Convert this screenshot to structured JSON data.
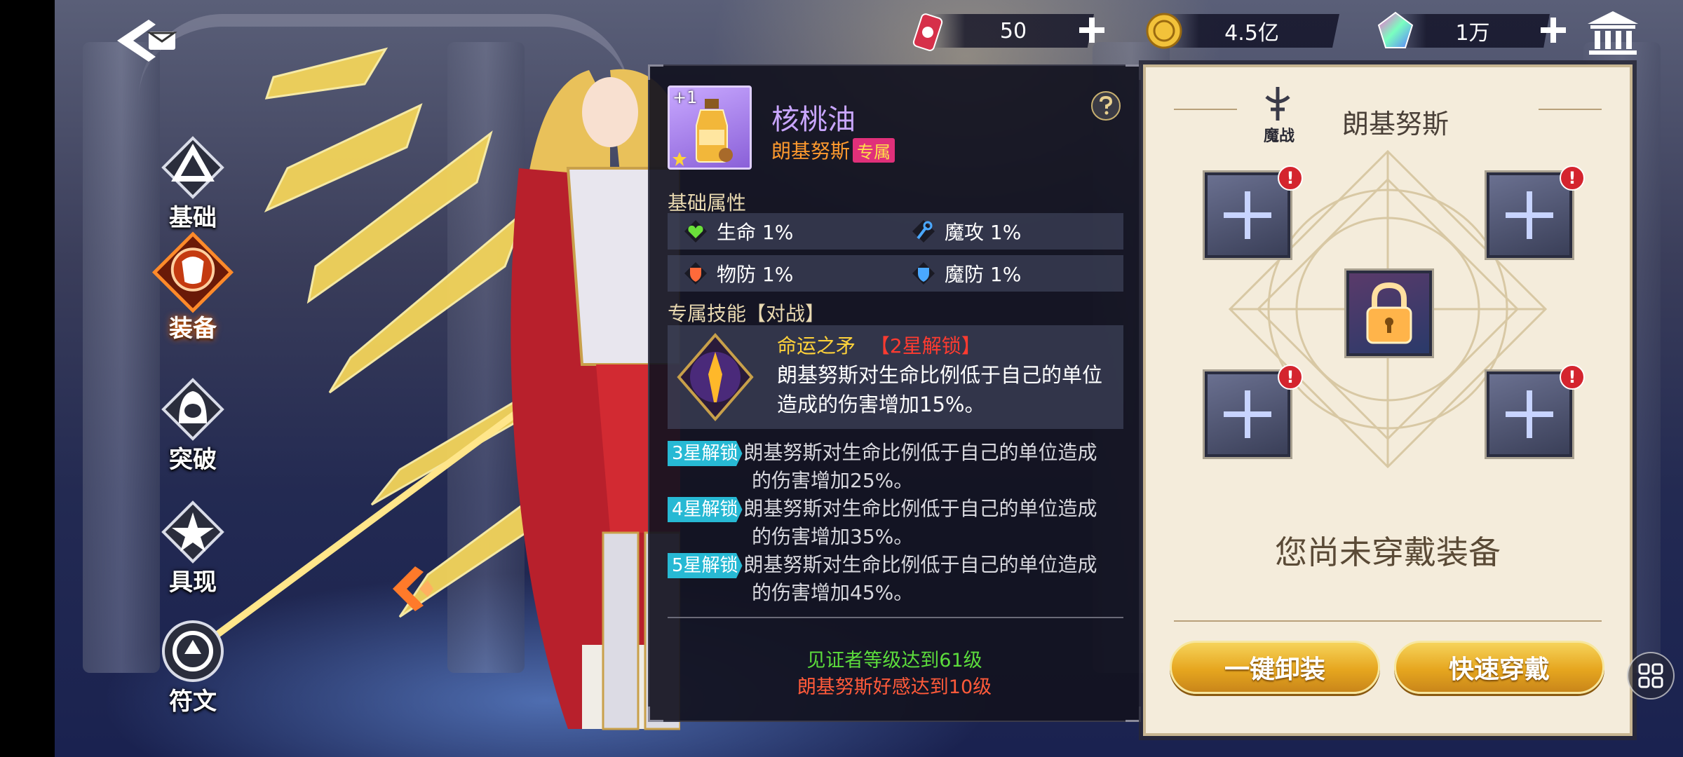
{
  "resources": [
    {
      "name": "stamina",
      "icon": "red-can-icon",
      "value": "50"
    },
    {
      "name": "gold",
      "icon": "gold-coin-icon",
      "value": "4.5亿"
    },
    {
      "name": "gem",
      "icon": "rainbow-gem-icon",
      "value": "1万"
    }
  ],
  "nav": [
    {
      "label": "基础",
      "icon": "triangle-emblem-icon",
      "active": false
    },
    {
      "label": "装备",
      "icon": "armor-emblem-icon",
      "active": true
    },
    {
      "label": "突破",
      "icon": "hood-emblem-icon",
      "active": false
    },
    {
      "label": "具现",
      "icon": "star-emblem-icon",
      "active": false
    },
    {
      "label": "符文",
      "icon": "rune-emblem-icon",
      "active": false
    }
  ],
  "item": {
    "name": "核桃油",
    "level": "+1",
    "owner": "朗基努斯",
    "exclusive_tag": "专属"
  },
  "base_attr": {
    "title": "基础属性",
    "rows": [
      [
        {
          "icon": "heart-icon",
          "text": "生命 1%"
        },
        {
          "icon": "staff-icon",
          "text": "魔攻 1%"
        }
      ],
      [
        {
          "icon": "shield-icon",
          "text": "物防 1%"
        },
        {
          "icon": "magic-shield-icon",
          "text": "魔防 1%"
        }
      ]
    ]
  },
  "skill": {
    "title": "专属技能【对战】",
    "name": "命运之矛",
    "lock": "【2星解锁】",
    "desc_line1": "朗基努斯对生命比例低于自己的单位",
    "desc_line2": "造成的伤害增加15%。",
    "upgrades": [
      {
        "badge": "3星解锁",
        "line1": "朗基努斯对生命比例低于自己的单位造成",
        "line2": "的伤害增加25%。"
      },
      {
        "badge": "4星解锁",
        "line1": "朗基努斯对生命比例低于自己的单位造成",
        "line2": "的伤害增加35%。"
      },
      {
        "badge": "5星解锁",
        "line1": "朗基努斯对生命比例低于自己的单位造成",
        "line2": "的伤害增加45%。"
      }
    ]
  },
  "conditions": {
    "line1": "见证者等级达到61级",
    "line2": "朗基努斯好感达到10级"
  },
  "equip_panel": {
    "class_label": "魔战",
    "hero_name": "朗基努斯",
    "empty_text": "您尚未穿戴装备",
    "btn_unequip": "一键卸装",
    "btn_quick": "快速穿戴"
  },
  "colors": {
    "accent_gold": "#e6a61f",
    "item_name": "#c9a6ff",
    "owner": "#ff9a2e",
    "exclusive_tag_bg": "#e0307a",
    "badge_bg": "#27b9d4",
    "lock_red": "#ff3b30",
    "cond_green": "#5cdc3c",
    "cond_red": "#ff5a3a"
  }
}
